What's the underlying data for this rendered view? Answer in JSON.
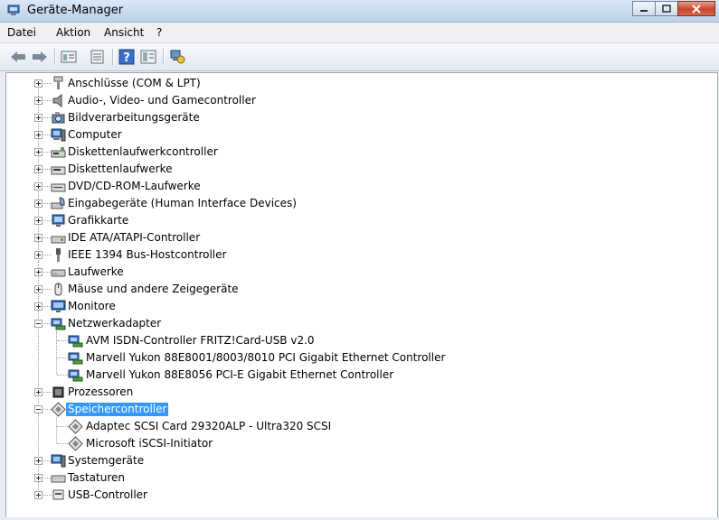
{
  "window": {
    "title": "Geräte-Manager"
  },
  "menu": [
    "Datei",
    "Aktion",
    "Ansicht",
    "?"
  ],
  "toolbar": [
    "back-icon",
    "forward-icon",
    "properties-view-icon",
    "scan-icon",
    "help-icon",
    "list-view-icon",
    "network-device-icon"
  ],
  "tree": [
    {
      "label": "Anschlüsse (COM & LPT)",
      "icon": "port-icon",
      "expanded": false
    },
    {
      "label": "Audio-, Video- und Gamecontroller",
      "icon": "speaker-icon",
      "expanded": false
    },
    {
      "label": "Bildverarbeitungsgeräte",
      "icon": "camera-icon",
      "expanded": false
    },
    {
      "label": "Computer",
      "icon": "computer-icon",
      "expanded": false
    },
    {
      "label": "Diskettenlaufwerkcontroller",
      "icon": "floppy-controller-icon",
      "expanded": false
    },
    {
      "label": "Diskettenlaufwerke",
      "icon": "floppy-drive-icon",
      "expanded": false
    },
    {
      "label": "DVD/CD-ROM-Laufwerke",
      "icon": "dvd-icon",
      "expanded": false
    },
    {
      "label": "Eingabegeräte (Human Interface Devices)",
      "icon": "hid-icon",
      "expanded": false
    },
    {
      "label": "Grafikkarte",
      "icon": "display-adapter-icon",
      "expanded": false
    },
    {
      "label": "IDE ATA/ATAPI-Controller",
      "icon": "ide-icon",
      "expanded": false
    },
    {
      "label": "IEEE 1394 Bus-Hostcontroller",
      "icon": "firewire-icon",
      "expanded": false
    },
    {
      "label": "Laufwerke",
      "icon": "disk-drive-icon",
      "expanded": false
    },
    {
      "label": "Mäuse und andere Zeigegeräte",
      "icon": "mouse-icon",
      "expanded": false
    },
    {
      "label": "Monitore",
      "icon": "monitor-icon",
      "expanded": false
    },
    {
      "label": "Netzwerkadapter",
      "icon": "network-adapter-icon",
      "expanded": true,
      "children": [
        {
          "label": "AVM ISDN-Controller FRITZ!Card-USB v2.0",
          "icon": "network-adapter-icon"
        },
        {
          "label": "Marvell Yukon 88E8001/8003/8010 PCI Gigabit Ethernet Controller",
          "icon": "network-adapter-icon"
        },
        {
          "label": "Marvell Yukon 88E8056 PCI-E Gigabit Ethernet Controller",
          "icon": "network-adapter-icon"
        }
      ]
    },
    {
      "label": "Prozessoren",
      "icon": "processor-icon",
      "expanded": false
    },
    {
      "label": "Speichercontroller",
      "icon": "storage-controller-icon",
      "expanded": true,
      "selected": true,
      "children": [
        {
          "label": "Adaptec SCSI Card 29320ALP - Ultra320 SCSI",
          "icon": "storage-controller-icon"
        },
        {
          "label": "Microsoft iSCSI-Initiator",
          "icon": "storage-controller-icon"
        }
      ]
    },
    {
      "label": "Systemgeräte",
      "icon": "system-device-icon",
      "expanded": false
    },
    {
      "label": "Tastaturen",
      "icon": "keyboard-icon",
      "expanded": false
    },
    {
      "label": "USB-Controller",
      "icon": "usb-icon",
      "expanded": false
    }
  ]
}
